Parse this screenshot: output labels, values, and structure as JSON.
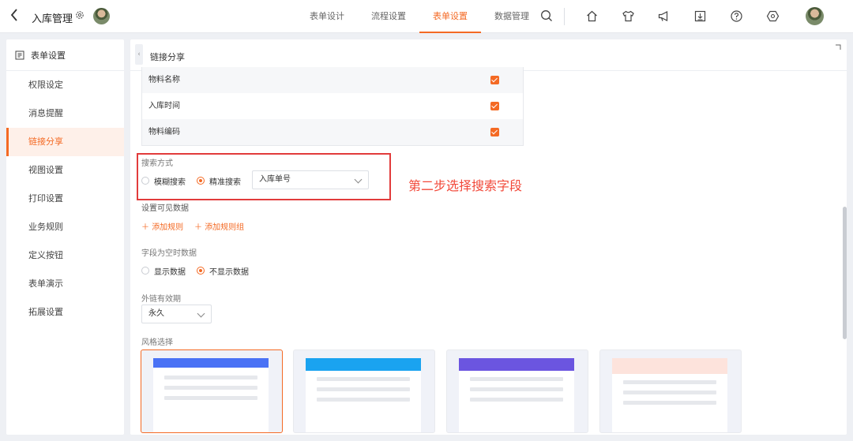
{
  "topbar": {
    "back_icon": "chevron-left-icon",
    "app_title": "入库管理",
    "tabs": [
      {
        "label": "表单设计",
        "active": false
      },
      {
        "label": "流程设置",
        "active": false
      },
      {
        "label": "表单设置",
        "active": true
      },
      {
        "label": "数据管理",
        "active": false
      }
    ],
    "icons": [
      "search-icon",
      "home-icon",
      "shirt-icon",
      "megaphone-icon",
      "download-icon",
      "help-icon",
      "hexagon-settings-icon"
    ]
  },
  "sidebar": {
    "title": "表单设置",
    "items": [
      {
        "label": "权限设定"
      },
      {
        "label": "消息提醒"
      },
      {
        "label": "链接分享",
        "active": true
      },
      {
        "label": "视图设置"
      },
      {
        "label": "打印设置"
      },
      {
        "label": "业务规则"
      },
      {
        "label": "定义按钮"
      },
      {
        "label": "表单演示"
      },
      {
        "label": "拓展设置"
      }
    ]
  },
  "main": {
    "title": "链接分享",
    "fields": [
      {
        "name": "物料名称",
        "checked": true
      },
      {
        "name": "入库时间",
        "checked": true
      },
      {
        "name": "物料编码",
        "checked": true
      }
    ],
    "search_mode": {
      "label": "搜索方式",
      "options": [
        "模糊搜索",
        "精准搜索"
      ],
      "selected": "精准搜索",
      "field_select": "入库单号"
    },
    "annotation": "第二步选择搜索字段",
    "visible_data": {
      "label": "设置可见数据",
      "add_rule": "添加规则",
      "add_rule_group": "添加规则组"
    },
    "empty_field": {
      "label": "字段为空时数据",
      "options": [
        "显示数据",
        "不显示数据"
      ],
      "selected": "不显示数据"
    },
    "link_validity": {
      "label": "外链有效期",
      "value": "永久"
    },
    "style": {
      "label": "风格选择",
      "selected_index": 0,
      "cards": [
        {
          "theme": "blue",
          "band_color": "#4a72f5"
        },
        {
          "theme": "sky",
          "band_color": "#1aa3f0"
        },
        {
          "theme": "purple",
          "band_color": "#6b55e0"
        },
        {
          "theme": "peach",
          "band_color": "#fde3dc"
        }
      ]
    }
  },
  "colors": {
    "accent": "#f46a24",
    "annotation_red": "#e23b3b"
  }
}
